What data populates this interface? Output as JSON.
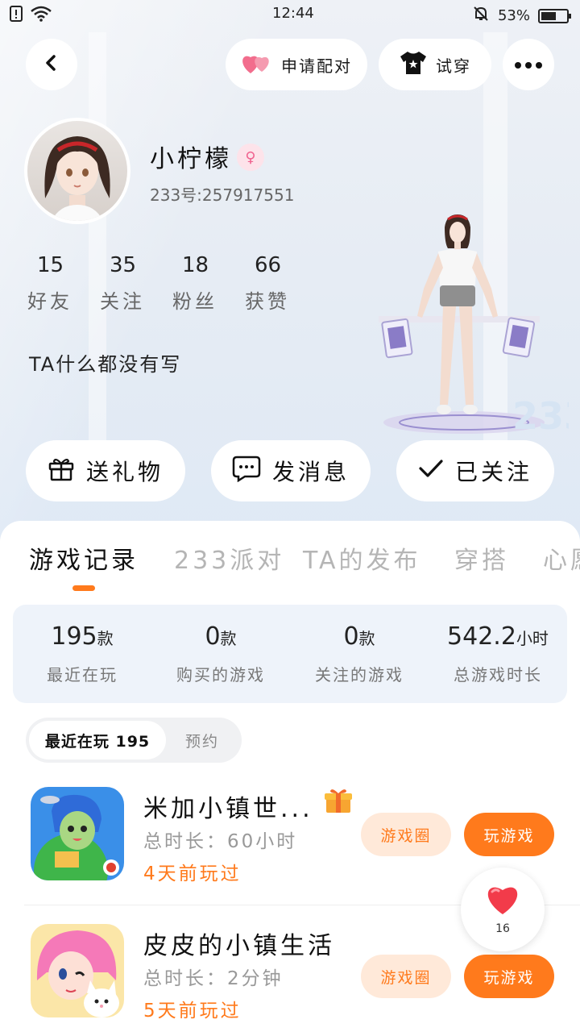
{
  "status_bar": {
    "time": "12:44",
    "battery": "53%",
    "battery_level": 0.53
  },
  "header": {
    "pair_label": "申请配对",
    "tryon_label": "试穿"
  },
  "profile": {
    "name": "小柠檬",
    "gender_symbol": "♀",
    "uid": "233号:257917551",
    "bio": "TA什么都没有写",
    "stats": [
      {
        "num": "15",
        "label": "好友"
      },
      {
        "num": "35",
        "label": "关注"
      },
      {
        "num": "18",
        "label": "粉丝"
      },
      {
        "num": "66",
        "label": "获赞"
      }
    ]
  },
  "actions": {
    "gift": "送礼物",
    "message": "发消息",
    "follow": "已关注"
  },
  "tabs": [
    "游戏记录",
    "233派对",
    "TA的发布",
    "穿搭",
    "心愿"
  ],
  "summary": [
    {
      "value": "195",
      "unit": "款",
      "label": "最近在玩"
    },
    {
      "value": "0",
      "unit": "款",
      "label": "购买的游戏"
    },
    {
      "value": "0",
      "unit": "款",
      "label": "关注的游戏"
    },
    {
      "value": "542.2",
      "unit": "小时",
      "label": "总游戏时长"
    }
  ],
  "segment": {
    "recent": "最近在玩 195",
    "reserve": "预约"
  },
  "games": [
    {
      "title": "米加小镇世...",
      "duration": "总时长：60小时",
      "last_played": "4天前玩过",
      "circle_btn": "游戏圈",
      "play_btn": "玩游戏"
    },
    {
      "title": "皮皮的小镇生活",
      "duration": "总时长：2分钟",
      "last_played": "5天前玩过",
      "circle_btn": "游戏圈",
      "play_btn": "玩游戏"
    }
  ],
  "like_float": {
    "count": "16"
  },
  "colors": {
    "accent": "#ff7a1c",
    "accent_soft": "#ffe9d9",
    "pink": "#f0628f"
  }
}
